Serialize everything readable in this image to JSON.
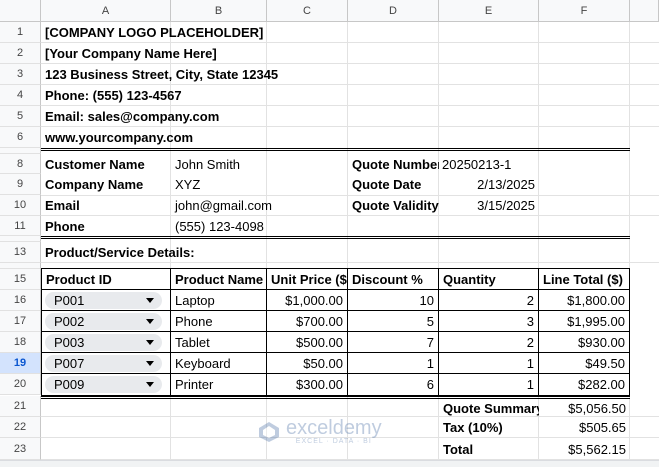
{
  "columns": [
    "A",
    "B",
    "C",
    "D",
    "E",
    "F"
  ],
  "rows": [
    "1",
    "2",
    "3",
    "4",
    "5",
    "6",
    "8",
    "9",
    "10",
    "11",
    "13",
    "15",
    "16",
    "17",
    "18",
    "19",
    "20",
    "21",
    "22",
    "23"
  ],
  "selected_row": "19",
  "company": {
    "logo": "[COMPANY LOGO PLACEHOLDER]",
    "name": "[Your Company Name Here]",
    "address": "123 Business Street, City, State 12345",
    "phone": "Phone: (555) 123-4567",
    "email": "Email: sales@company.com",
    "website": "www.yourcompany.com"
  },
  "customer": {
    "name_label": "Customer Name",
    "name_value": "John Smith",
    "company_label": "Company Name",
    "company_value": "XYZ",
    "email_label": "Email",
    "email_value": "john@gmail.com",
    "phone_label": "Phone",
    "phone_value": "(555) 123-4098"
  },
  "quote": {
    "number_label": "Quote Number",
    "number_value": "20250213-1",
    "date_label": "Quote Date",
    "date_value": "2/13/2025",
    "validity_label": "Quote Validity",
    "validity_value": "3/15/2025"
  },
  "details_heading": "Product/Service Details:",
  "table": {
    "headers": [
      "Product ID",
      "Product Name",
      "Unit Price ($)",
      "Discount %",
      "Quantity",
      "Line Total ($)"
    ],
    "rows": [
      {
        "id": "P001",
        "name": "Laptop",
        "price": "$1,000.00",
        "discount": "10",
        "qty": "2",
        "total": "$1,800.00"
      },
      {
        "id": "P002",
        "name": "Phone",
        "price": "$700.00",
        "discount": "5",
        "qty": "3",
        "total": "$1,995.00"
      },
      {
        "id": "P003",
        "name": "Tablet",
        "price": "$500.00",
        "discount": "7",
        "qty": "2",
        "total": "$930.00"
      },
      {
        "id": "P007",
        "name": "Keyboard",
        "price": "$50.00",
        "discount": "1",
        "qty": "1",
        "total": "$49.50"
      },
      {
        "id": "P009",
        "name": "Printer",
        "price": "$300.00",
        "discount": "6",
        "qty": "1",
        "total": "$282.00"
      }
    ]
  },
  "summary": {
    "summary_label": "Quote Summary",
    "summary_value": "$5,056.50",
    "tax_label": "Tax (10%)",
    "tax_value": "$505.65",
    "total_label": "Total",
    "total_value": "$5,562.15"
  },
  "watermark": {
    "name": "exceldemy",
    "tagline": "EXCEL · DATA · BI"
  },
  "colors": {
    "header_bg": "#f8f9fa",
    "selected_row_bg": "#d3e3fd",
    "chip_bg": "#e8eaed"
  }
}
